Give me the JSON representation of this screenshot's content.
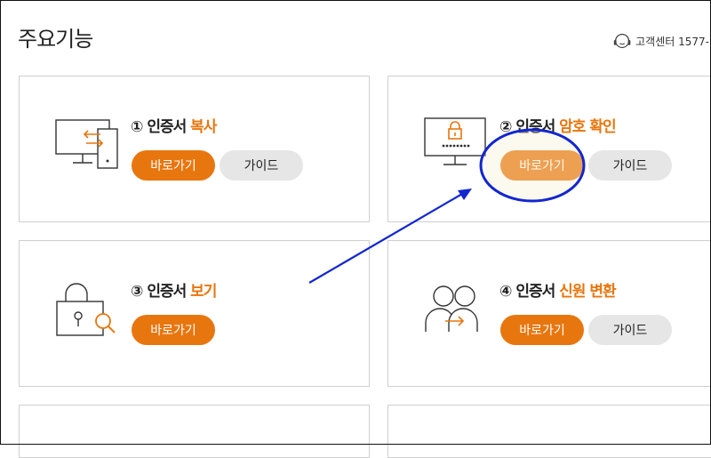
{
  "header": {
    "title": "주요기능",
    "support_label": "고객센터 1577-"
  },
  "colors": {
    "accent": "#e8760e",
    "guide_bg": "#e6e6e6",
    "annotation": "#1226d0"
  },
  "cards": [
    {
      "num": "①",
      "prefix": " 인증서 ",
      "accent": "복사",
      "go_label": "바로가기",
      "guide_label": "가이드",
      "icon": "computer-transfer-icon"
    },
    {
      "num": "②",
      "prefix": " 인증서 ",
      "accent": "암호 확인",
      "go_label": "바로가기",
      "guide_label": "가이드",
      "icon": "monitor-lock-icon"
    },
    {
      "num": "③",
      "prefix": " 인증서 ",
      "accent": "보기",
      "go_label": "바로가기",
      "icon": "lock-search-icon"
    },
    {
      "num": "④",
      "prefix": " 인증서 ",
      "accent": "신원 변환",
      "go_label": "바로가기",
      "guide_label": "가이드",
      "icon": "users-transfer-icon"
    }
  ]
}
